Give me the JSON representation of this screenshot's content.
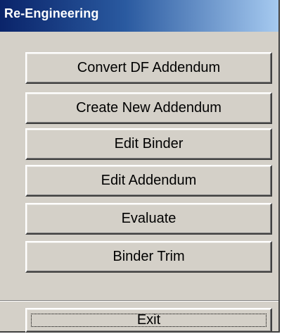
{
  "window": {
    "title": "Re-Engineering"
  },
  "menu": {
    "buttons": [
      {
        "label": "Convert DF Addendum"
      },
      {
        "label": "Create New Addendum"
      },
      {
        "label": "Edit Binder"
      },
      {
        "label": "Edit Addendum"
      },
      {
        "label": "Evaluate"
      },
      {
        "label": "Binder Trim"
      }
    ],
    "exit_label": "Exit"
  },
  "colors": {
    "titlebar_start": "#0a246a",
    "titlebar_end": "#a6caf0",
    "face": "#d4d0c8"
  }
}
